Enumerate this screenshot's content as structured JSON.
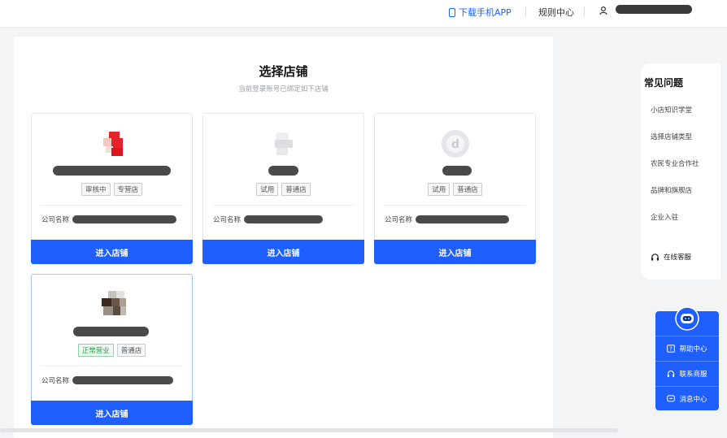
{
  "header": {
    "download_app": "下载手机APP",
    "rules_center": "规则中心"
  },
  "page": {
    "title": "选择店铺",
    "subtitle": "当前登录账号已绑定如下店铺"
  },
  "common": {
    "company_label": "公司名称",
    "enter_button": "进入店铺"
  },
  "shops": [
    {
      "tags": [
        "审核中",
        "专营店"
      ],
      "logo": "red-blocks-logo"
    },
    {
      "tags": [
        "试用",
        "普通店"
      ],
      "logo": "gray-shape-logo"
    },
    {
      "tags": [
        "试用",
        "普通店"
      ],
      "logo": "circle-d-logo"
    },
    {
      "tags": [
        "正常营业",
        "普通店"
      ],
      "logo": "brown-blocks-logo",
      "selected": true
    }
  ],
  "faq": {
    "title": "常见问题",
    "items": [
      "小店知识学堂",
      "选择店铺类型",
      "农民专业合作社",
      "品牌和旗舰店",
      "企业入驻"
    ],
    "online_service": "在线客服"
  },
  "help_widget": {
    "items": [
      "帮助中心",
      "联系商服",
      "消息中心"
    ]
  },
  "colors": {
    "primary": "#1f5fff",
    "status_green": "#22a24a"
  }
}
